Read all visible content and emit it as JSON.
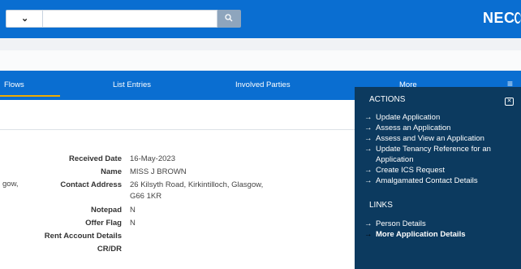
{
  "header": {
    "dropdown_icon": "chevron-down-icon",
    "search": {
      "value": "",
      "placeholder": ""
    },
    "search_icon": "search-icon",
    "brand": "NEC"
  },
  "tabs": [
    {
      "label": "Flows"
    },
    {
      "label": "List Entries"
    },
    {
      "label": "Involved Parties"
    },
    {
      "label": "More"
    }
  ],
  "tab_extra": {
    "more_chevron": "▾",
    "menu_icon": "≡"
  },
  "details": {
    "left_fragment_1": "gow,",
    "rows": [
      {
        "label": "Received Date",
        "value": "16-May-2023"
      },
      {
        "label": "Name",
        "value": "MISS J BROWN"
      },
      {
        "label": "Contact Address",
        "value": "26 Kilsyth Road, Kirkintilloch, Glasgow,",
        "value2": "G66 1KR"
      },
      {
        "label": "Notepad",
        "value": "N"
      },
      {
        "label": "Offer Flag",
        "value": "N"
      },
      {
        "label": "Rent Account Details",
        "value": ""
      },
      {
        "label": "CR/DR",
        "value": ""
      }
    ]
  },
  "actions_panel": {
    "actions_title": "ACTIONS",
    "close_icon": "close-icon",
    "actions": [
      {
        "label": "Update Application"
      },
      {
        "label": "Assess an Application"
      },
      {
        "label": "Assess and View an Application"
      },
      {
        "label": "Update Tenancy Reference for an",
        "label2": "Application"
      },
      {
        "label": "Create ICS Request"
      },
      {
        "label": "Amalgamated Contact Details"
      }
    ],
    "links_title": "LINKS",
    "links": [
      {
        "label": "Person Details"
      },
      {
        "label": "More Application Details"
      }
    ],
    "arrow": "→"
  },
  "colors": {
    "header_blue": "#0a6ed1",
    "panel_navy": "#0c3a5f",
    "tab_accent": "#f0ab00"
  }
}
